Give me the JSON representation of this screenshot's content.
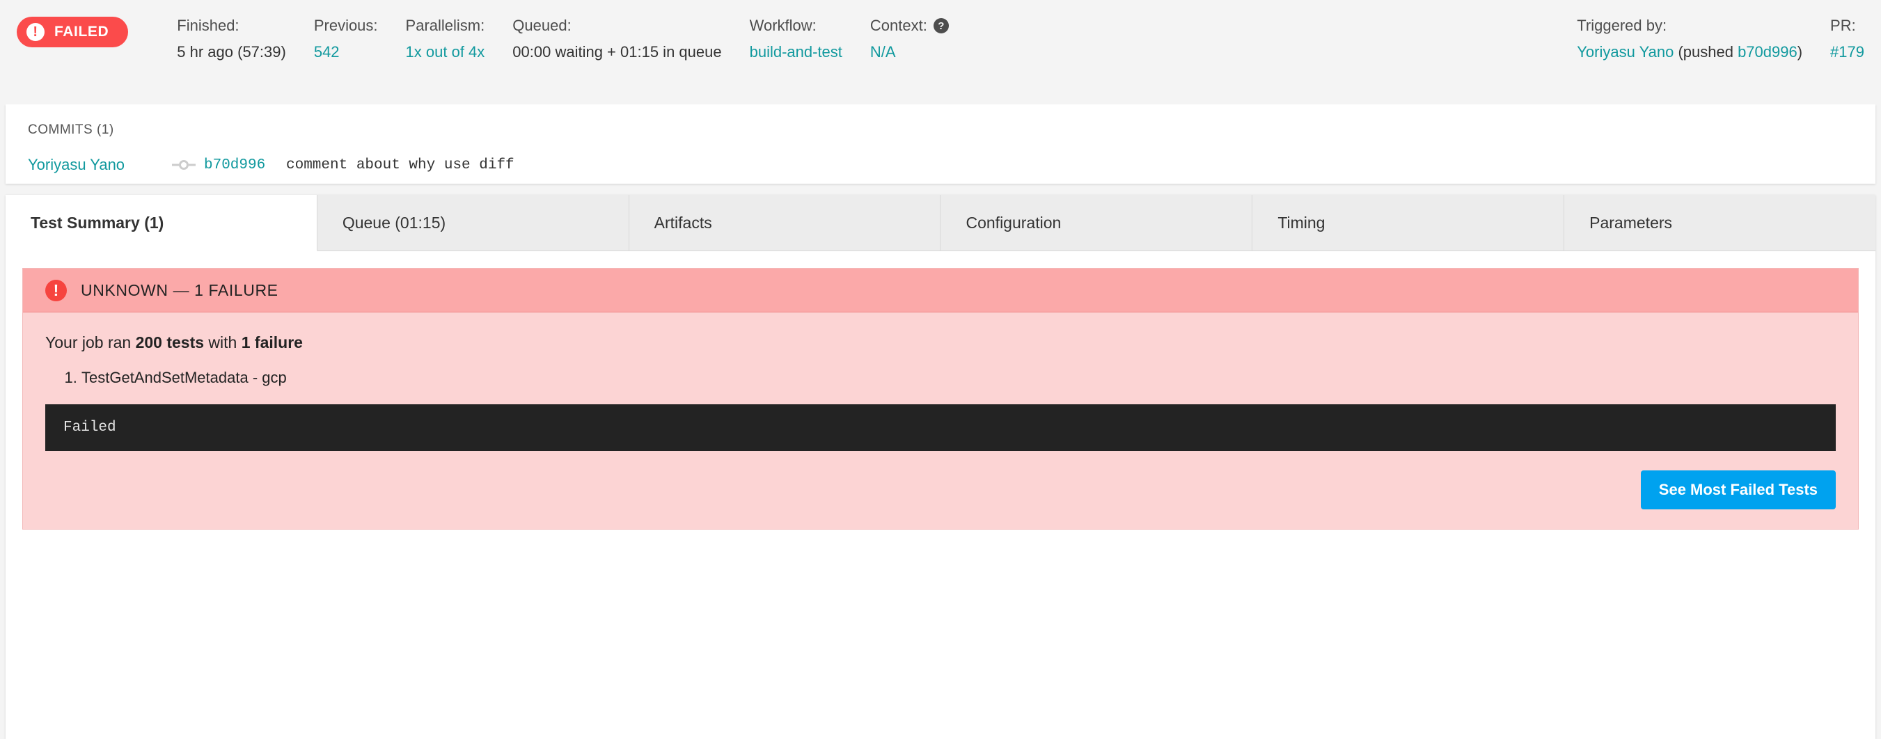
{
  "header": {
    "status": {
      "label": "FAILED",
      "icon": "exclamation-circle-icon",
      "color": "#fb4b4b"
    },
    "items": [
      {
        "label": "Finished:",
        "value": "5 hr ago (57:39)"
      },
      {
        "label": "Previous:",
        "value": "542"
      },
      {
        "label": "Parallelism:",
        "value": "1x out of 4x"
      },
      {
        "label": "Queued:",
        "value": "00:00 waiting + 01:15 in queue"
      },
      {
        "label": "Workflow:",
        "value": "build-and-test"
      },
      {
        "label": "Context:",
        "value": "N/A"
      },
      {
        "label": "Triggered by:",
        "value": "Yoriyasu Yano"
      },
      {
        "label": "PR:",
        "value": "#179"
      }
    ],
    "finished_label": "Finished:",
    "finished_value": "5 hr ago (57:39)",
    "previous_label": "Previous:",
    "previous_value": "542",
    "parallelism_label": "Parallelism:",
    "parallelism_value": "1x out of 4x",
    "queued_label": "Queued:",
    "queued_value": "00:00 waiting + 01:15 in queue",
    "workflow_label": "Workflow:",
    "workflow_value": "build-and-test",
    "context_label": "Context:",
    "context_help_icon": "?",
    "context_value": "N/A",
    "triggered_label": "Triggered by:",
    "triggered_user": "Yoriyasu Yano",
    "triggered_pushed_prefix": " (pushed ",
    "triggered_sha": "b70d996",
    "triggered_pushed_suffix": ")",
    "pr_label": "PR:",
    "pr_value": "#179",
    "link_color": "#11999e"
  },
  "commits": {
    "title": "COMMITS (1)",
    "rows": [
      {
        "author": "Yoriyasu Yano",
        "icon": "git-commit-icon",
        "sha": "b70d996",
        "subject": "comment about why use diff"
      }
    ],
    "row0_author": "Yoriyasu Yano",
    "row0_sha": "b70d996",
    "row0_subject": "comment about why use diff"
  },
  "tabs": [
    {
      "label": "Test Summary (1)",
      "active": true
    },
    {
      "label": "Queue (01:15)",
      "active": false
    },
    {
      "label": "Artifacts",
      "active": false
    },
    {
      "label": "Configuration",
      "active": false
    },
    {
      "label": "Timing",
      "active": false
    },
    {
      "label": "Parameters",
      "active": false
    }
  ],
  "alert": {
    "head_icon": "exclamation-circle-icon",
    "head_text": "UNKNOWN — 1 FAILURE",
    "summary_prefix": "Your job ran ",
    "summary_tests": "200 tests",
    "summary_middle": " with ",
    "summary_failures": "1 failure",
    "failures": [
      "TestGetAndSetMetadata - gcp"
    ],
    "failure0": "TestGetAndSetMetadata - gcp",
    "code_output": "Failed",
    "button_label": "See Most Failed Tests",
    "button_color": "#00a2ef",
    "head_bg": "#fba9a9",
    "body_bg": "#fcd4d4"
  }
}
